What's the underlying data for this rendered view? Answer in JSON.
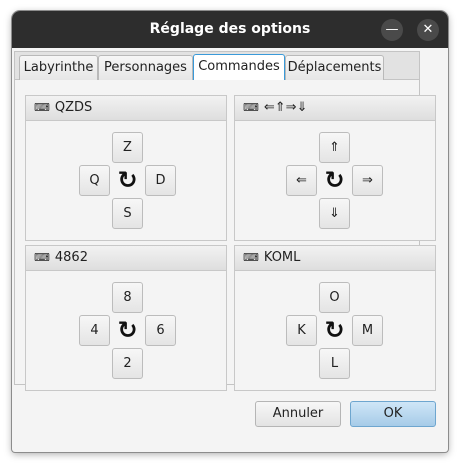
{
  "window": {
    "title": "Réglage des options",
    "minimize_glyph": "—",
    "close_glyph": "✕"
  },
  "tabs": [
    "Labyrinthe",
    "Personnages",
    "Commandes",
    "Déplacements"
  ],
  "active_tab": "Commandes",
  "panels": [
    {
      "title": "QZDS",
      "up": "Z",
      "left": "Q",
      "right": "D",
      "down": "S"
    },
    {
      "title": "⇐⇑⇒⇓",
      "up": "⇑",
      "left": "⇐",
      "right": "⇒",
      "down": "⇓"
    },
    {
      "title": "4862",
      "up": "8",
      "left": "4",
      "right": "6",
      "down": "2"
    },
    {
      "title": "KOML",
      "up": "O",
      "left": "K",
      "right": "M",
      "down": "L"
    }
  ],
  "icons": {
    "keyboard": "⌨",
    "rotate": "↻"
  },
  "buttons": {
    "cancel": "Annuler",
    "ok": "OK"
  },
  "colors": {
    "titlebar": "#2d2d2d",
    "active_tab_border": "#3a9ad9",
    "ok_button": "#a6cbe8"
  }
}
